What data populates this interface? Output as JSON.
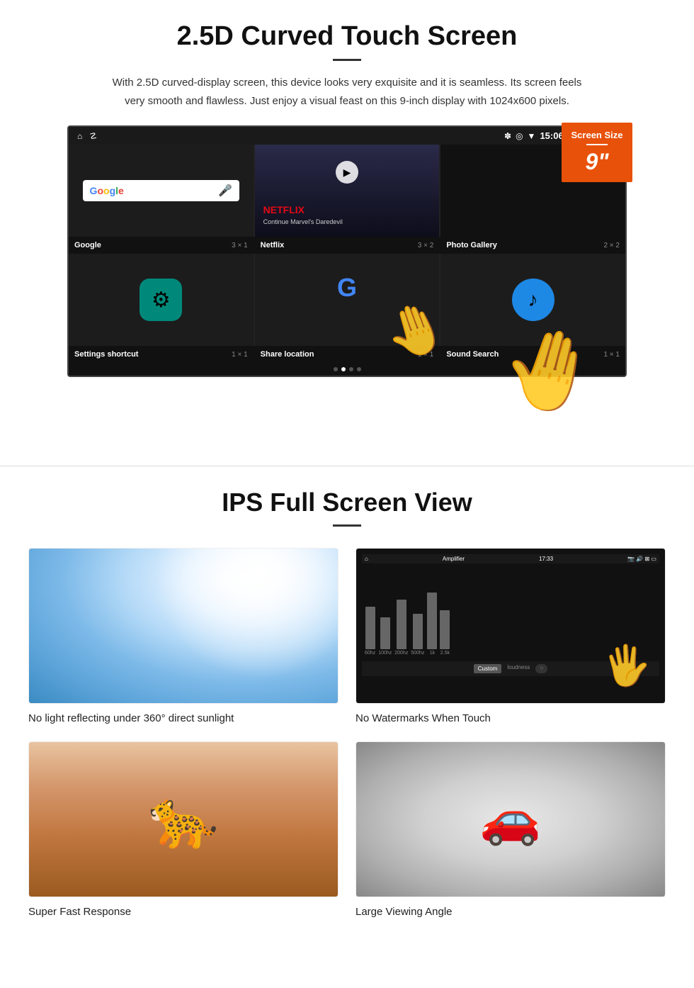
{
  "section1": {
    "title": "2.5D Curved Touch Screen",
    "description": "With 2.5D curved-display screen, this device looks very exquisite and it is seamless. Its screen feels very smooth and flawless. Just enjoy a visual feast on this 9-inch display with 1024x600 pixels.",
    "badge": {
      "title": "Screen Size",
      "size": "9\""
    },
    "status_bar": {
      "time": "15:06"
    },
    "apps": [
      {
        "name": "Google",
        "size": "3 × 1"
      },
      {
        "name": "Netflix",
        "size": "3 × 2"
      },
      {
        "name": "Photo Gallery",
        "size": "2 × 2"
      },
      {
        "name": "Settings shortcut",
        "size": "1 × 1"
      },
      {
        "name": "Share location",
        "size": "1 × 1"
      },
      {
        "name": "Sound Search",
        "size": "1 × 1"
      }
    ],
    "netflix_text": "NETFLIX",
    "netflix_subtitle": "Continue Marvel's Daredevil"
  },
  "section2": {
    "title": "IPS Full Screen View",
    "features": [
      {
        "id": "sunlight",
        "caption": "No light reflecting under 360° direct sunlight"
      },
      {
        "id": "equalizer",
        "caption": "No Watermarks When Touch"
      },
      {
        "id": "cheetah",
        "caption": "Super Fast Response"
      },
      {
        "id": "car",
        "caption": "Large Viewing Angle"
      }
    ]
  }
}
